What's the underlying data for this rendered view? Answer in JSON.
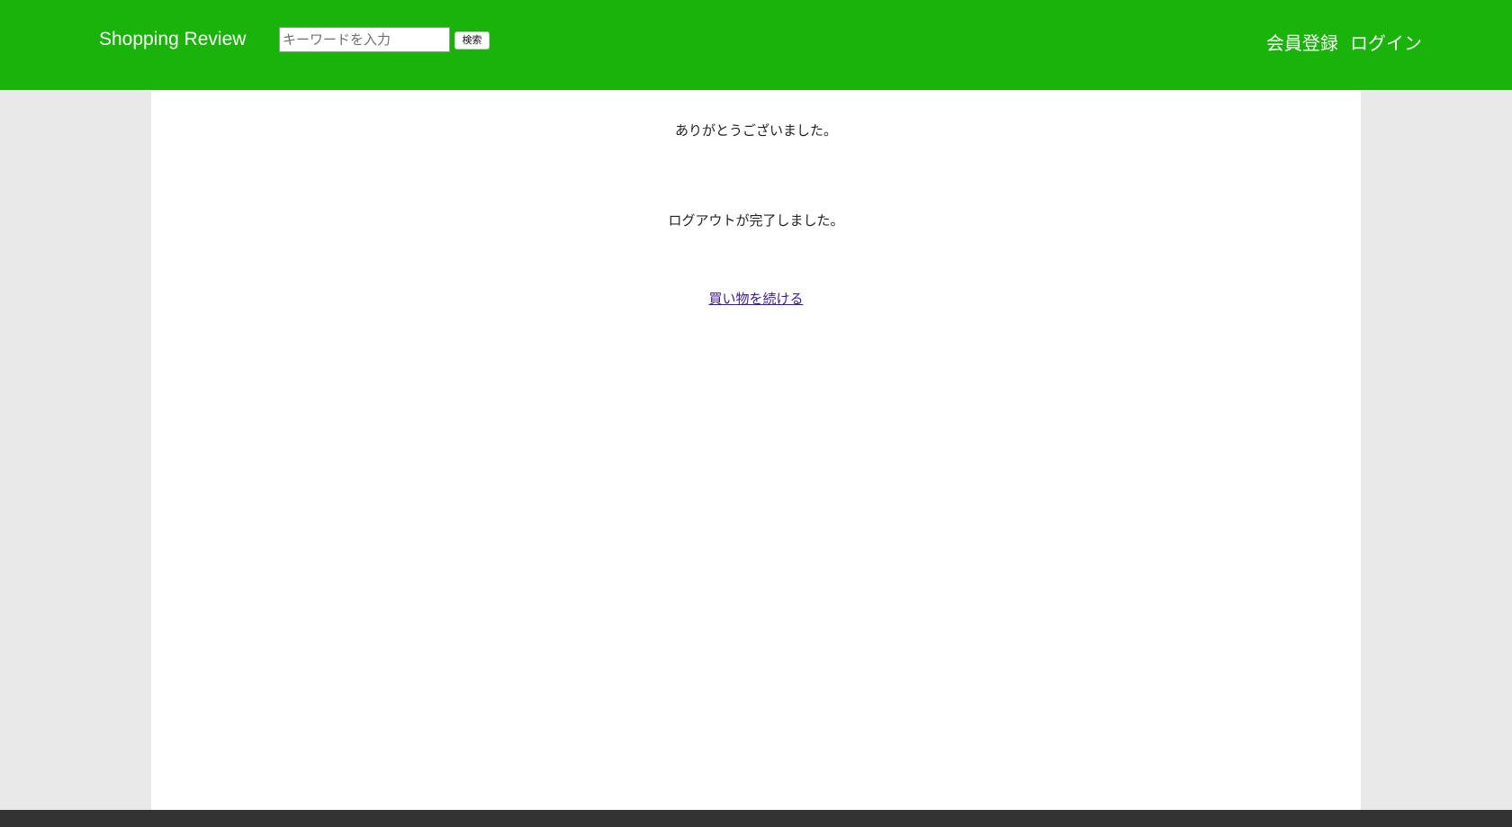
{
  "header": {
    "brand": "Shopping Review",
    "search": {
      "placeholder": "キーワードを入力",
      "button_label": "検索"
    },
    "nav": {
      "register": "会員登録",
      "login": "ログイン"
    }
  },
  "main": {
    "thanks_message": "ありがとうございました。",
    "logout_message": "ログアウトが完了しました。",
    "continue_link": "買い物を続ける"
  },
  "colors": {
    "header_bg": "#19b30a",
    "page_bg": "#e9e9e9",
    "footer_bg": "#333333",
    "link": "#3d1b8e"
  }
}
